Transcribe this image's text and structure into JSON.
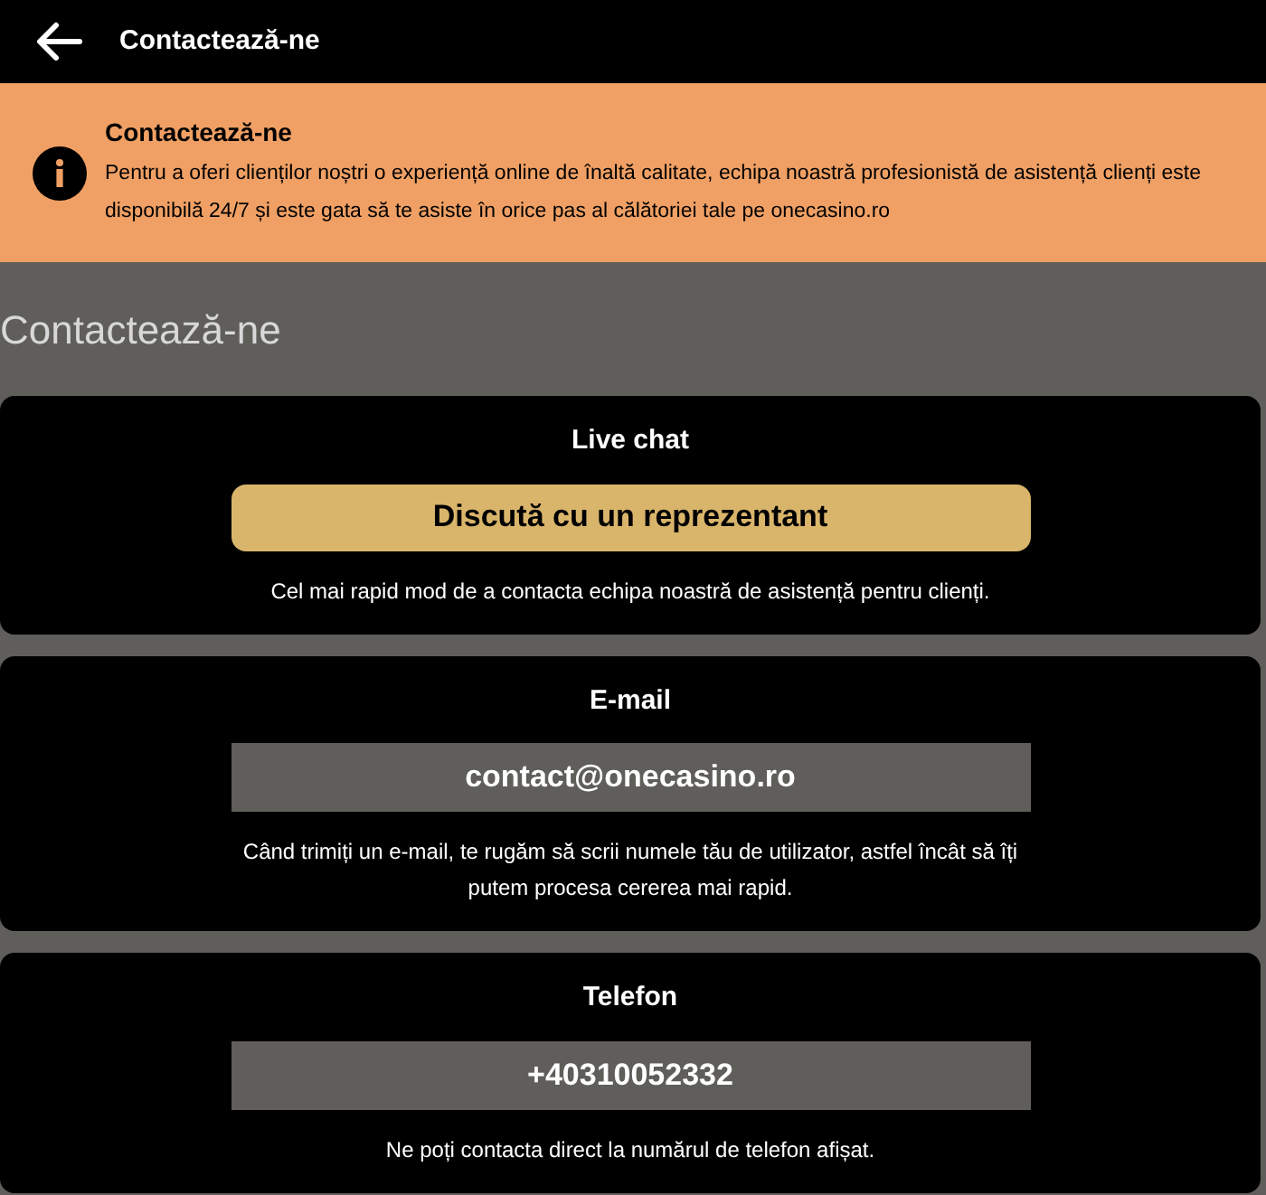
{
  "header": {
    "title": "Contactează-ne"
  },
  "banner": {
    "title": "Contactează-ne",
    "text": "Pentru a oferi clienților noștri o experiență online de înaltă calitate, echipa noastră profesionistă de asistență clienți este disponibilă 24/7 și este gata să te asiste în orice pas al călătoriei tale pe onecasino.ro"
  },
  "page_title": "Contactează-ne",
  "cards": [
    {
      "kind": "button",
      "title": "Live chat",
      "action": "Discută cu un reprezentant",
      "note": "Cel mai rapid mod de a contacta echipa noastră de asistență pentru clienți."
    },
    {
      "kind": "value",
      "title": "E-mail",
      "action": "contact@onecasino.ro",
      "note": "Când trimiți un e-mail, te rugăm să scrii numele tău de utilizator, astfel încât să îți putem procesa cererea mai rapid."
    },
    {
      "kind": "value",
      "title": "Telefon",
      "action": "+40310052332",
      "note": "Ne poți contacta direct la numărul de telefon afișat."
    }
  ]
}
